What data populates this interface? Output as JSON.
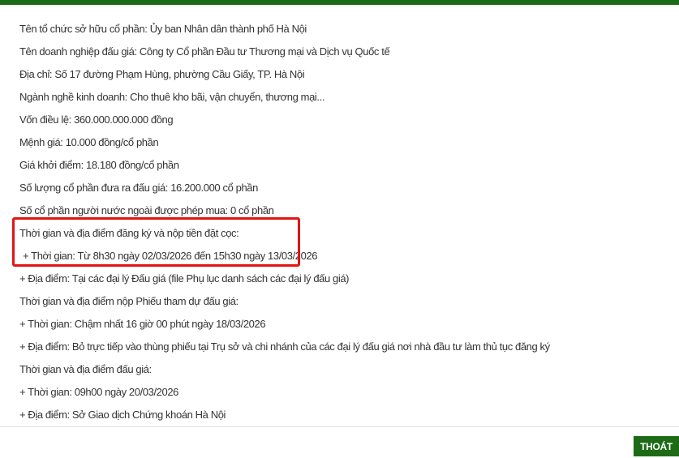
{
  "colors": {
    "brand_green": "#1e6b17",
    "highlight_red": "#e41414",
    "text": "#333333"
  },
  "info_lines": [
    "Tên tổ chức sở hữu cổ phần: Ủy ban Nhân dân thành phố Hà Nội",
    "Tên doanh nghiệp đấu giá: Công ty Cổ phần Đầu tư Thương mại và Dịch vụ Quốc tế",
    "Địa chỉ: Số 17 đường Phạm Hùng, phường Cầu Giấy, TP. Hà Nội",
    "Ngành nghề kinh doanh: Cho thuê kho bãi, vận chuyển, thương mại...",
    "Vốn điều lệ: 360.000.000.000 đồng",
    "Mệnh giá: 10.000 đồng/cổ phần",
    "Giá khởi điểm: 18.180 đồng/cổ phần",
    "Số lượng cổ phần đưa ra đấu giá: 16.200.000 cổ phần",
    "Số cổ phần người nước ngoài được phép mua: 0 cổ phần",
    "Thời gian và địa điểm đăng ký và nộp tiền đặt cọc:",
    "+ Thời gian: Từ 8h30 ngày 02/03/2026 đến 15h30 ngày 13/03/2026",
    "+ Địa điểm: Tại các đại lý Đấu giá (file Phụ lục danh sách các đại lý đấu giá)",
    "Thời gian và địa điểm nộp Phiếu tham dự đấu giá:",
    "+ Thời gian: Chậm nhất 16 giờ 00 phút ngày 18/03/2026",
    "+ Địa điểm: Bỏ trực tiếp vào thùng phiếu tại Trụ sở và chi nhánh của các đại lý đấu giá nơi nhà đầu tư làm thủ tục đăng ký",
    "Thời gian và địa điểm đấu giá:",
    "+ Thời gian: 09h00 ngày 20/03/2026",
    "+ Địa điểm: Sở Giao dịch Chứng khoán Hà Nội"
  ],
  "footer": {
    "exit_label": "THOÁT"
  }
}
